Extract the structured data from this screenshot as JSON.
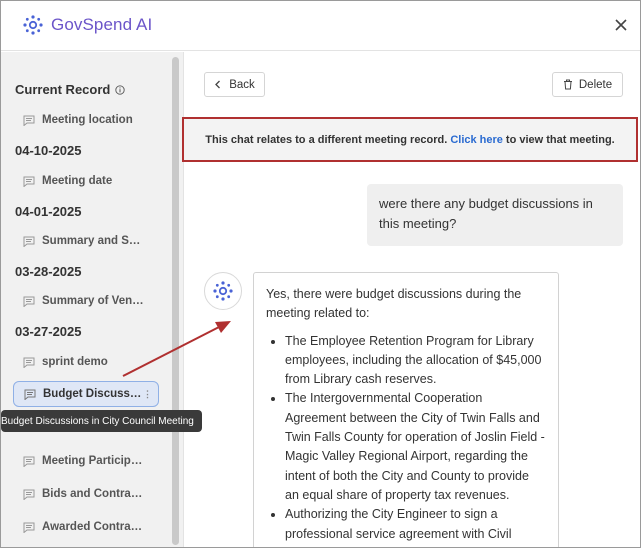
{
  "app": {
    "name": "GovSpend AI"
  },
  "sidebar": {
    "section_title": "Current Record",
    "groups": [
      {
        "date": "",
        "items": [
          {
            "label": "Meeting location"
          }
        ]
      },
      {
        "date": "04-10-2025",
        "items": [
          {
            "label": "Meeting date"
          }
        ]
      },
      {
        "date": "04-01-2025",
        "items": [
          {
            "label": "Summary and Sentiment"
          }
        ]
      },
      {
        "date": "03-28-2025",
        "items": [
          {
            "label": "Summary of Vendors"
          }
        ]
      },
      {
        "date": "03-27-2025",
        "items": [
          {
            "label": "sprint demo"
          },
          {
            "label": "Budget Discussions in City Council Meeting",
            "active": true
          },
          {
            "label": ""
          },
          {
            "label": "Meeting Participants"
          },
          {
            "label": "Bids and Contracts"
          },
          {
            "label": "Awarded Contract Details"
          }
        ]
      }
    ],
    "tooltip": "Budget Discussions in City Council Meeting"
  },
  "toolbar": {
    "back_label": "Back",
    "delete_label": "Delete"
  },
  "banner": {
    "text_before": "This chat relates to a different meeting record.",
    "link": "Click here",
    "text_after": "to view that meeting."
  },
  "chat": {
    "user_message": "were there any budget discussions in this meeting?",
    "bot_intro": "Yes, there were budget discussions during the meeting related to:",
    "bot_points": [
      "The Employee Retention Program for Library employees, including the allocation of $45,000 from Library cash reserves.",
      "The Intergovernmental Cooperation Agreement between the City of Twin Falls and Twin Falls County for operation of Joslin Field - Magic Valley Regional Airport, regarding the intent of both the City and County to provide an equal share of property tax revenues.",
      "Authorizing the City Engineer to sign a professional service agreement with Civil"
    ]
  },
  "colors": {
    "brand": "#6b55c9",
    "accent": "#2a6bd1",
    "banner_border": "#b03030",
    "annotation_arrow": "#b03030"
  },
  "icons": {
    "logo": "gear-sparkle-icon",
    "close": "close-icon",
    "chat": "chat-icon",
    "trash": "trash-icon",
    "back": "chevron-left-icon",
    "info": "info-icon"
  }
}
